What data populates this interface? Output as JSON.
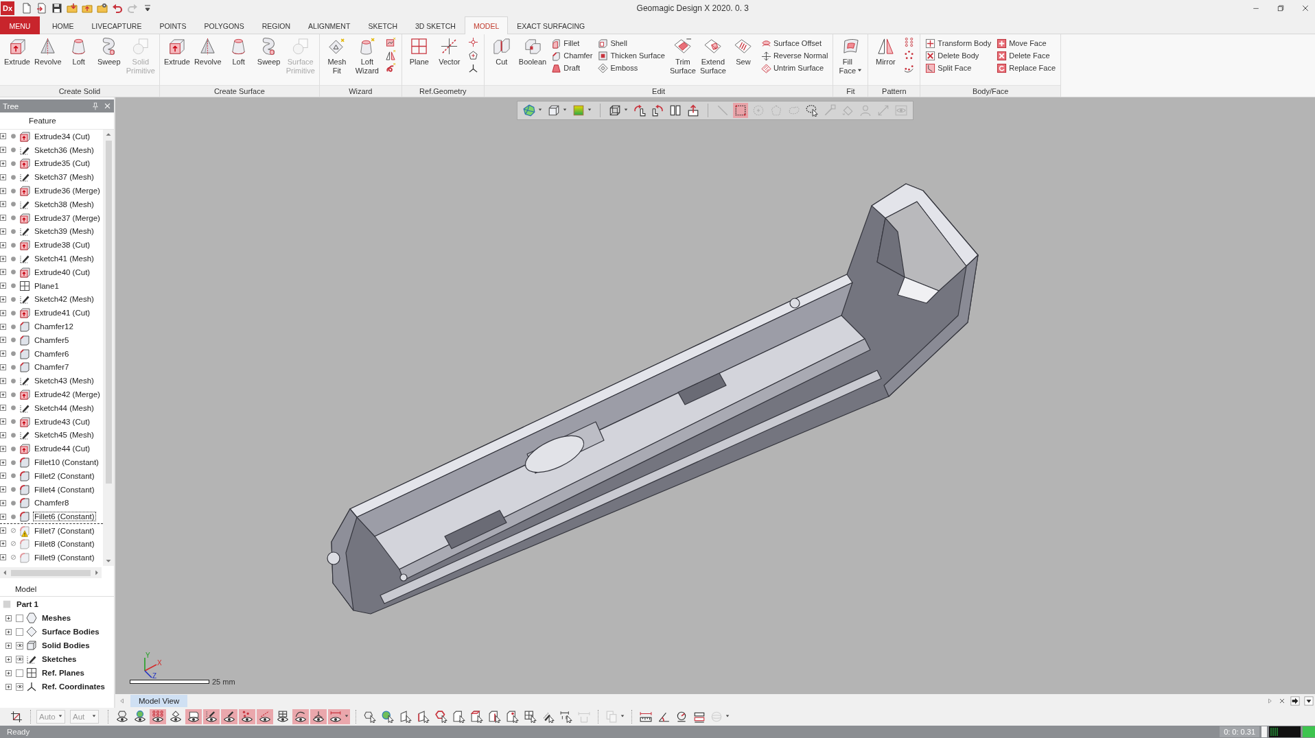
{
  "window": {
    "app_logo": "Dx",
    "title": "Geomagic Design X 2020. 0. 3"
  },
  "quick_access": [
    {
      "disabled": false
    },
    {
      "disabled": false
    },
    {
      "disabled": false
    },
    {
      "disabled": false
    },
    {
      "disabled": false
    },
    {
      "disabled": false
    },
    {
      "disabled": false
    },
    {
      "disabled": true
    },
    {
      "disabled": false
    }
  ],
  "ribbon_tabs": [
    {
      "label": "MENU",
      "kind": "menu",
      "selected": false
    },
    {
      "label": "HOME",
      "kind": "tab",
      "selected": false
    },
    {
      "label": "LIVECAPTURE",
      "kind": "tab",
      "selected": false
    },
    {
      "label": "POINTS",
      "kind": "tab",
      "selected": false
    },
    {
      "label": "POLYGONS",
      "kind": "tab",
      "selected": false
    },
    {
      "label": "REGION",
      "kind": "tab",
      "selected": false
    },
    {
      "label": "ALIGNMENT",
      "kind": "tab",
      "selected": false
    },
    {
      "label": "SKETCH",
      "kind": "tab",
      "selected": false
    },
    {
      "label": "3D SKETCH",
      "kind": "tab",
      "selected": false
    },
    {
      "label": "MODEL",
      "kind": "tab",
      "selected": true
    },
    {
      "label": "EXACT SURFACING",
      "kind": "tab",
      "selected": false
    }
  ],
  "ribbon_groups": [
    {
      "label": "Create Solid",
      "items": [
        {
          "kind": "large",
          "label": "Extrude",
          "disabled": false
        },
        {
          "kind": "large",
          "label": "Revolve",
          "disabled": false
        },
        {
          "kind": "large",
          "label": "Loft",
          "disabled": false
        },
        {
          "kind": "large",
          "label": "Sweep",
          "disabled": false
        },
        {
          "kind": "large",
          "label": "Solid Primitive",
          "disabled": true
        }
      ]
    },
    {
      "label": "Create Surface",
      "items": [
        {
          "kind": "large",
          "label": "Extrude",
          "disabled": false
        },
        {
          "kind": "large",
          "label": "Revolve",
          "disabled": false
        },
        {
          "kind": "large",
          "label": "Loft",
          "disabled": false
        },
        {
          "kind": "large",
          "label": "Sweep",
          "disabled": false
        },
        {
          "kind": "large",
          "label": "Surface Primitive",
          "disabled": true
        }
      ]
    },
    {
      "label": "Wizard",
      "items": [
        {
          "kind": "large",
          "label": "Mesh Fit",
          "disabled": false
        },
        {
          "kind": "large",
          "label": "Loft Wizard",
          "disabled": false
        },
        {
          "kind": "icons"
        }
      ]
    },
    {
      "label": "Ref.Geometry",
      "items": [
        {
          "kind": "large",
          "label": "Plane",
          "disabled": false
        },
        {
          "kind": "large",
          "label": "Vector",
          "disabled": false
        },
        {
          "kind": "icons"
        }
      ]
    },
    {
      "label": "Edit",
      "items": [
        {
          "kind": "large",
          "label": "Cut",
          "disabled": false
        },
        {
          "kind": "large",
          "label": "Boolean",
          "disabled": false
        },
        {
          "kind": "column",
          "tools": [
            {
              "label": "Fillet"
            },
            {
              "label": "Chamfer"
            },
            {
              "label": "Draft"
            }
          ]
        },
        {
          "kind": "column",
          "tools": [
            {
              "label": "Shell"
            },
            {
              "label": "Thicken Surface"
            },
            {
              "label": "Emboss"
            }
          ]
        },
        {
          "kind": "large",
          "label": "Trim Surface",
          "disabled": false
        },
        {
          "kind": "large",
          "label": "Extend Surface",
          "disabled": false
        },
        {
          "kind": "large",
          "label": "Sew",
          "disabled": false
        },
        {
          "kind": "column",
          "tools": [
            {
              "label": "Surface Offset"
            },
            {
              "label": "Reverse Normal"
            },
            {
              "label": "Untrim Surface"
            }
          ]
        }
      ]
    },
    {
      "label": "Fit",
      "items": [
        {
          "kind": "large_menu",
          "label": "Fill Face",
          "disabled": false
        }
      ]
    },
    {
      "label": "Pattern",
      "items": [
        {
          "kind": "large",
          "label": "Mirror",
          "disabled": false
        },
        {
          "kind": "icons"
        }
      ]
    },
    {
      "label": "Body/Face",
      "items": [
        {
          "kind": "column",
          "tools": [
            {
              "label": "Transform Body"
            },
            {
              "label": "Delete Body"
            },
            {
              "label": "Split Face"
            }
          ]
        },
        {
          "kind": "column",
          "tools": [
            {
              "label": "Move Face"
            },
            {
              "label": "Delete Face"
            },
            {
              "label": "Replace Face"
            }
          ]
        }
      ]
    }
  ],
  "feature_tree": {
    "title": "Tree",
    "column": "Feature",
    "items": [
      {
        "label": "Extrude34 (Cut)",
        "kind": "extrude",
        "selected": false,
        "suppressed": false,
        "warning": false
      },
      {
        "label": "Sketch36 (Mesh)",
        "kind": "sketch",
        "selected": false,
        "suppressed": false,
        "warning": false
      },
      {
        "label": "Extrude35 (Cut)",
        "kind": "extrude",
        "selected": false,
        "suppressed": false,
        "warning": false
      },
      {
        "label": "Sketch37 (Mesh)",
        "kind": "sketch",
        "selected": false,
        "suppressed": false,
        "warning": false
      },
      {
        "label": "Extrude36 (Merge)",
        "kind": "extrude",
        "selected": false,
        "suppressed": false,
        "warning": false
      },
      {
        "label": "Sketch38 (Mesh)",
        "kind": "sketch",
        "selected": false,
        "suppressed": false,
        "warning": false
      },
      {
        "label": "Extrude37 (Merge)",
        "kind": "extrude",
        "selected": false,
        "suppressed": false,
        "warning": false
      },
      {
        "label": "Sketch39 (Mesh)",
        "kind": "sketch",
        "selected": false,
        "suppressed": false,
        "warning": false
      },
      {
        "label": "Extrude38 (Cut)",
        "kind": "extrude",
        "selected": false,
        "suppressed": false,
        "warning": false
      },
      {
        "label": "Sketch41 (Mesh)",
        "kind": "sketch",
        "selected": false,
        "suppressed": false,
        "warning": false
      },
      {
        "label": "Extrude40 (Cut)",
        "kind": "extrude",
        "selected": false,
        "suppressed": false,
        "warning": false
      },
      {
        "label": "Plane1",
        "kind": "plane",
        "selected": false,
        "suppressed": false,
        "warning": false
      },
      {
        "label": "Sketch42 (Mesh)",
        "kind": "sketch",
        "selected": false,
        "suppressed": false,
        "warning": false
      },
      {
        "label": "Extrude41 (Cut)",
        "kind": "extrude",
        "selected": false,
        "suppressed": false,
        "warning": false
      },
      {
        "label": "Chamfer12",
        "kind": "chamfer",
        "selected": false,
        "suppressed": false,
        "warning": false
      },
      {
        "label": "Chamfer5",
        "kind": "chamfer",
        "selected": false,
        "suppressed": false,
        "warning": false
      },
      {
        "label": "Chamfer6",
        "kind": "chamfer",
        "selected": false,
        "suppressed": false,
        "warning": false
      },
      {
        "label": "Chamfer7",
        "kind": "chamfer",
        "selected": false,
        "suppressed": false,
        "warning": false
      },
      {
        "label": "Sketch43 (Mesh)",
        "kind": "sketch",
        "selected": false,
        "suppressed": false,
        "warning": false
      },
      {
        "label": "Extrude42 (Merge)",
        "kind": "extrude",
        "selected": false,
        "suppressed": false,
        "warning": false
      },
      {
        "label": "Sketch44 (Mesh)",
        "kind": "sketch",
        "selected": false,
        "suppressed": false,
        "warning": false
      },
      {
        "label": "Extrude43 (Cut)",
        "kind": "extrude",
        "selected": false,
        "suppressed": false,
        "warning": false
      },
      {
        "label": "Sketch45 (Mesh)",
        "kind": "sketch",
        "selected": false,
        "suppressed": false,
        "warning": false
      },
      {
        "label": "Extrude44 (Cut)",
        "kind": "extrude",
        "selected": false,
        "suppressed": false,
        "warning": false
      },
      {
        "label": "Fillet10 (Constant)",
        "kind": "fillet",
        "selected": false,
        "suppressed": false,
        "warning": false
      },
      {
        "label": "Fillet2 (Constant)",
        "kind": "fillet",
        "selected": false,
        "suppressed": false,
        "warning": false
      },
      {
        "label": "Fillet4 (Constant)",
        "kind": "fillet",
        "selected": false,
        "suppressed": false,
        "warning": false
      },
      {
        "label": "Chamfer8",
        "kind": "fillet",
        "selected": false,
        "suppressed": false,
        "warning": false
      },
      {
        "label": "Fillet6 (Constant)",
        "kind": "fillet",
        "selected": true,
        "suppressed": false,
        "warning": false
      },
      {
        "label": "Fillet7 (Constant)",
        "kind": "fillet",
        "selected": false,
        "suppressed": true,
        "warning": true
      },
      {
        "label": "Fillet8 (Constant)",
        "kind": "fillet",
        "selected": false,
        "suppressed": true,
        "warning": false
      },
      {
        "label": "Fillet9 (Constant)",
        "kind": "fillet",
        "selected": false,
        "suppressed": true,
        "warning": false
      }
    ]
  },
  "model_tree": {
    "title": "Model",
    "root": "Part 1",
    "items": [
      {
        "label": "Meshes",
        "kind": "mesh",
        "visible": false
      },
      {
        "label": "Surface Bodies",
        "kind": "surface",
        "visible": false
      },
      {
        "label": "Solid Bodies",
        "kind": "solid",
        "visible": true
      },
      {
        "label": "Sketches",
        "kind": "sketch",
        "visible": true
      },
      {
        "label": "Ref. Planes",
        "kind": "plane",
        "visible": false
      },
      {
        "label": "Ref. Coordinates",
        "kind": "coordinates",
        "visible": true
      }
    ]
  },
  "viewport": {
    "toolbar": {
      "groups": [
        {
          "tools": [
            {
              "kind": "menu",
              "on": false,
              "disabled": false
            },
            {
              "kind": "menu",
              "on": false,
              "disabled": false
            },
            {
              "kind": "menu",
              "on": false,
              "disabled": false
            }
          ]
        },
        {
          "tools": [
            {
              "kind": "menu",
              "on": false,
              "disabled": false
            },
            {
              "kind": "button",
              "on": false,
              "disabled": false
            },
            {
              "kind": "button",
              "on": false,
              "disabled": false
            },
            {
              "kind": "button",
              "on": false,
              "disabled": false
            },
            {
              "kind": "button",
              "on": false,
              "disabled": false
            }
          ]
        },
        {
          "tools": [
            {
              "kind": "button",
              "on": false,
              "disabled": true
            },
            {
              "kind": "button",
              "on": true,
              "disabled": false
            },
            {
              "kind": "button",
              "on": false,
              "disabled": true
            },
            {
              "kind": "button",
              "on": false,
              "disabled": true
            },
            {
              "kind": "button",
              "on": false,
              "disabled": true
            },
            {
              "kind": "button",
              "on": false,
              "disabled": false
            },
            {
              "kind": "button",
              "on": false,
              "disabled": true
            },
            {
              "kind": "button",
              "on": false,
              "disabled": true
            },
            {
              "kind": "button",
              "on": false,
              "disabled": true
            },
            {
              "kind": "button",
              "on": false,
              "disabled": true
            },
            {
              "kind": "button",
              "on": false,
              "disabled": true
            }
          ]
        }
      ]
    },
    "axes": {
      "x": "X",
      "y": "Y",
      "z": "Z"
    },
    "scale_label": "25 mm"
  },
  "view_tabs": [
    {
      "label": "Model View",
      "selected": true
    }
  ],
  "bottom_toolbar": {
    "groups": [
      {
        "kind": "tools",
        "tools": [
          {
            "kind": "button",
            "on": false,
            "disabled": false
          }
        ]
      },
      {
        "kind": "fields",
        "fields": [
          {
            "value": "Auto",
            "disabled": true
          },
          {
            "value": "Aut",
            "disabled": true
          }
        ]
      },
      {
        "kind": "tools",
        "tools": [
          {
            "kind": "button",
            "on": false,
            "disabled": false
          },
          {
            "kind": "button",
            "on": false,
            "disabled": false
          },
          {
            "kind": "button",
            "on": true,
            "disabled": false
          },
          {
            "kind": "button",
            "on": false,
            "disabled": false
          },
          {
            "kind": "button",
            "on": true,
            "disabled": false
          },
          {
            "kind": "button",
            "on": true,
            "disabled": false
          },
          {
            "kind": "button",
            "on": true,
            "disabled": false
          },
          {
            "kind": "button",
            "on": true,
            "disabled": false
          },
          {
            "kind": "button",
            "on": true,
            "disabled": false
          },
          {
            "kind": "button",
            "on": false,
            "disabled": false
          },
          {
            "kind": "button",
            "on": true,
            "disabled": false
          },
          {
            "kind": "button",
            "on": true,
            "disabled": false
          },
          {
            "kind": "menu",
            "on": true,
            "disabled": false
          }
        ]
      },
      {
        "kind": "tools",
        "tools": [
          {
            "kind": "button",
            "on": false,
            "disabled": false
          },
          {
            "kind": "button",
            "on": false,
            "disabled": false
          },
          {
            "kind": "button",
            "on": false,
            "disabled": false
          },
          {
            "kind": "button",
            "on": false,
            "disabled": false
          },
          {
            "kind": "button",
            "on": false,
            "disabled": false
          },
          {
            "kind": "button",
            "on": false,
            "disabled": false
          },
          {
            "kind": "button",
            "on": false,
            "disabled": false
          },
          {
            "kind": "button",
            "on": false,
            "disabled": false
          },
          {
            "kind": "button",
            "on": false,
            "disabled": false
          },
          {
            "kind": "button",
            "on": false,
            "disabled": false
          },
          {
            "kind": "button",
            "on": false,
            "disabled": false
          },
          {
            "kind": "button",
            "on": false,
            "disabled": false
          },
          {
            "kind": "button",
            "on": false,
            "disabled": true
          }
        ]
      },
      {
        "kind": "tools",
        "tools": [
          {
            "kind": "menu",
            "on": false,
            "disabled": true
          }
        ]
      },
      {
        "kind": "tools",
        "tools": [
          {
            "kind": "button",
            "on": false,
            "disabled": false
          },
          {
            "kind": "button",
            "on": false,
            "disabled": false
          },
          {
            "kind": "button",
            "on": false,
            "disabled": false
          },
          {
            "kind": "button",
            "on": false,
            "disabled": false
          },
          {
            "kind": "menu",
            "on": false,
            "disabled": true
          }
        ]
      }
    ]
  },
  "status_bar": {
    "text": "Ready",
    "elapsed": "0: 0: 0.31"
  }
}
